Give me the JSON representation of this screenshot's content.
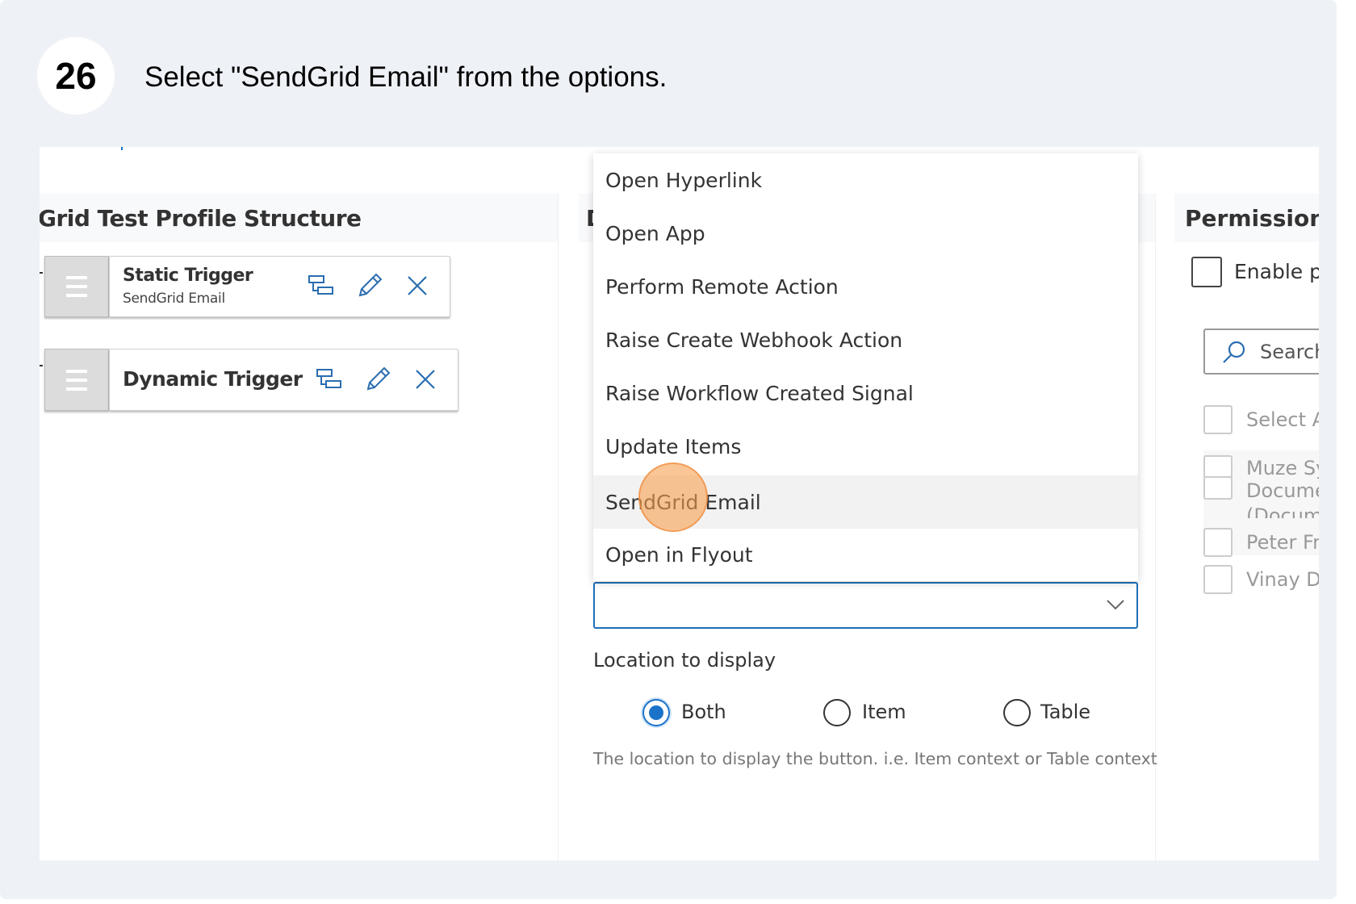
{
  "step": {
    "number": "26",
    "instruction": "Select \"SendGrid Email\" from the options."
  },
  "left_panel": {
    "title": "Grid Test Profile Structure",
    "items": [
      {
        "title": "Static Trigger",
        "subtitle": "SendGrid Email",
        "icons": [
          "hierarchy-icon",
          "pencil-icon",
          "close-icon"
        ]
      },
      {
        "title": "Dynamic Trigger",
        "icons": [
          "hierarchy-icon",
          "pencil-icon",
          "close-icon"
        ]
      }
    ]
  },
  "middle_panel": {
    "title_partial": "D",
    "dropdown": {
      "options": [
        "Open Hyperlink",
        "Open App",
        "Perform Remote Action",
        "Raise Create Webhook Action",
        "Raise Workflow Created Signal",
        "Update Items",
        "SendGrid Email",
        "Open in Flyout"
      ],
      "highlighted": "SendGrid Email",
      "selected_value": ""
    },
    "location": {
      "label": "Location to display",
      "options": [
        "Both",
        "Item",
        "Table"
      ],
      "selected": "Both",
      "help": "The location to display the button. i.e. Item context or Table context"
    }
  },
  "right_panel": {
    "title": "Permissions",
    "enable_label": "Enable pe",
    "search_placeholder": "Search",
    "list": [
      "Select A",
      "Muze Sy",
      "Docume",
      "(Docum",
      "Peter Fr",
      "Vinay D"
    ]
  },
  "colors": {
    "accent": "#1a73c9",
    "icon_blue": "#2a6db0",
    "click_marker": "#f7a050",
    "background": "#eef2f7"
  }
}
